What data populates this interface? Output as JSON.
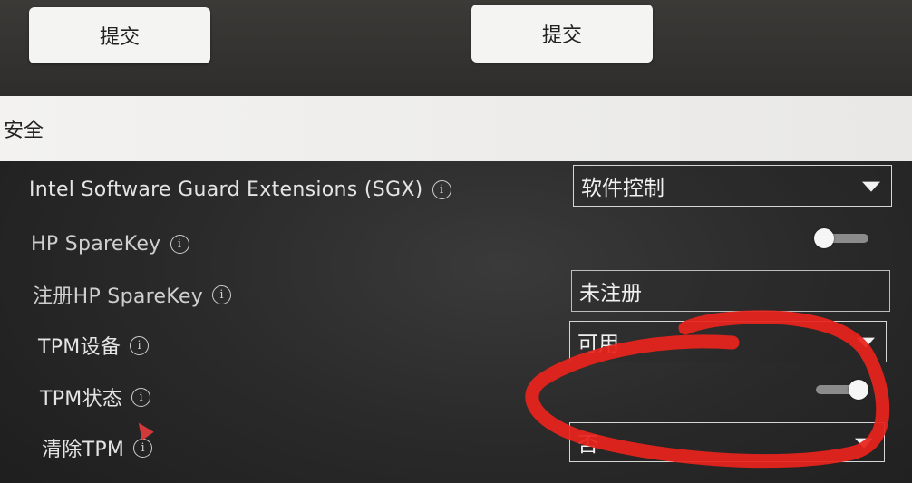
{
  "buttons": {
    "submit_left": "提交",
    "submit_right": "提交"
  },
  "section": {
    "title": "安全"
  },
  "rows": [
    {
      "label": "Intel Software Guard Extensions (SGX)",
      "control": "select",
      "value": "软件控制"
    },
    {
      "label": "HP SpareKey",
      "control": "toggle",
      "state": "off"
    },
    {
      "label": "注册HP SpareKey",
      "control": "text",
      "value": "未注册"
    },
    {
      "label": "TPM设备",
      "control": "select",
      "value": "可用"
    },
    {
      "label": "TPM状态",
      "control": "toggle",
      "state": "on"
    },
    {
      "label": "清除TPM",
      "control": "select",
      "value": "否"
    }
  ],
  "info_icon_glyph": "i",
  "colors": {
    "annotation_red": "#e8231c",
    "header_bg": "#f1f0ee",
    "button_bg": "#f4f4f2"
  }
}
